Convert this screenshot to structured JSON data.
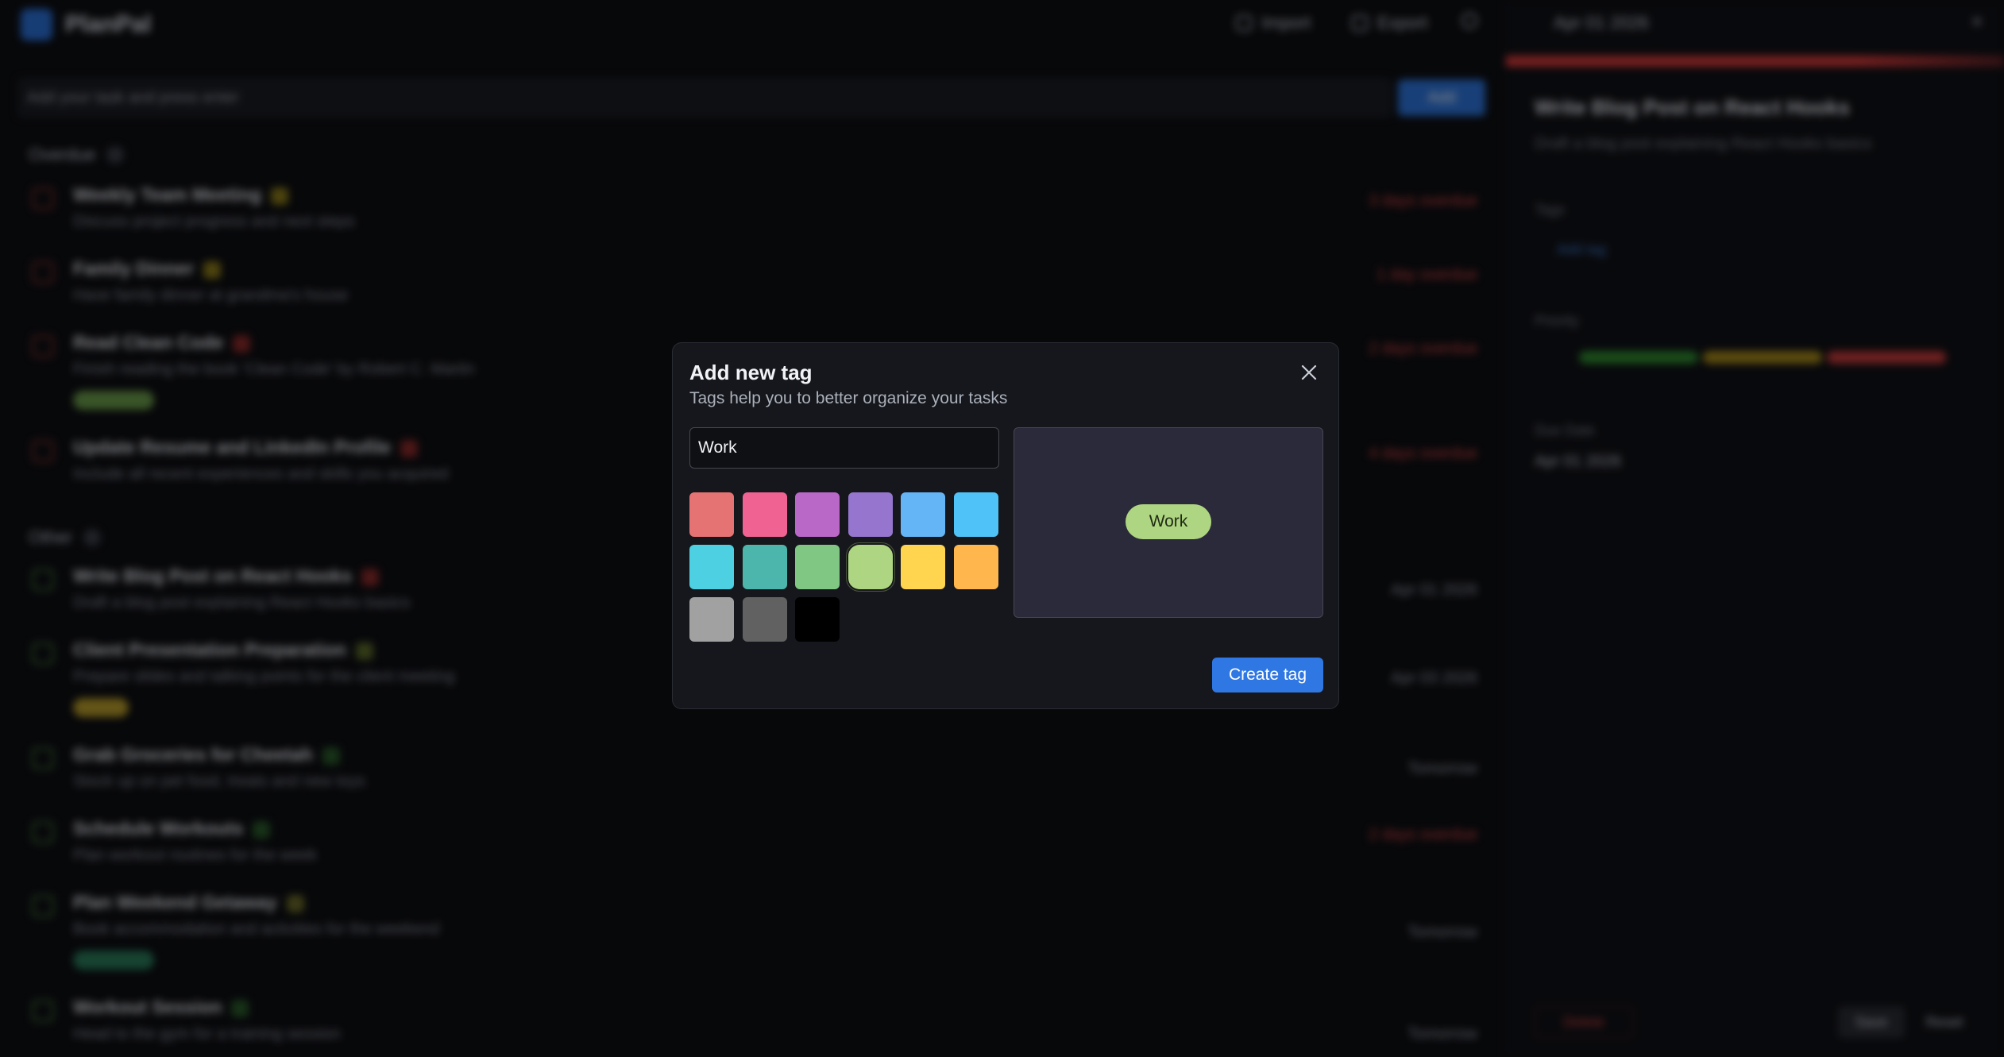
{
  "background": {
    "app_name": "PlanPal",
    "top_actions": [
      "Import",
      "Export"
    ],
    "search_placeholder": "Add your task and press enter",
    "add_label": "Add",
    "sections": [
      {
        "name": "Overdue",
        "tasks": [
          {
            "title": "Weekly Team Meeting",
            "desc": "Discuss project progress and next steps",
            "due": "3 days overdue"
          },
          {
            "title": "Family Dinner",
            "desc": "Have family dinner at grandma's house",
            "due": "1 day overdue"
          },
          {
            "title": "Read Clean Code",
            "desc": "Finish reading the book 'Clean Code' by Robert C. Martin",
            "due": "2 days overdue"
          },
          {
            "title": "Update Resume and LinkedIn Profile",
            "desc": "Include all recent experiences and skills you acquired",
            "due": "4 days overdue"
          }
        ]
      },
      {
        "name": "Other",
        "tasks": [
          {
            "title": "Write Blog Post on React Hooks",
            "desc": "Draft a blog post explaining React Hooks basics",
            "due": "Apr 01 2026"
          },
          {
            "title": "Client Presentation Preparation",
            "desc": "Prepare slides and talking points for the client meeting",
            "due": "Apr 03 2026"
          },
          {
            "title": "Grab Groceries for Cheetah",
            "desc": "Stock up on pet food, treats and new toys",
            "due": "Tomorrow"
          },
          {
            "title": "Schedule Workouts",
            "desc": "Plan workout routines for the week",
            "due": "2 days overdue"
          },
          {
            "title": "Plan Weekend Getaway",
            "desc": "Book accommodation and activities for the weekend",
            "due": "Tomorrow"
          },
          {
            "title": "Workout Session",
            "desc": "Head to the gym for a training session",
            "due": "Tomorrow"
          }
        ]
      }
    ],
    "detail": {
      "date": "Apr 01 2026",
      "title": "Write Blog Post on React Hooks",
      "subtitle": "Draft a blog post explaining React Hooks basics",
      "tags_label": "Tags",
      "add_tag": "Add tag",
      "priority_label": "Priority",
      "due_label": "Due Date",
      "due_value": "Apr 01 2026",
      "delete": "Delete",
      "save": "Save",
      "reset": "Reset"
    }
  },
  "modal": {
    "title": "Add new tag",
    "subtitle": "Tags help you to better organize your tasks",
    "input_value": "Work",
    "preview_label": "Work",
    "create_label": "Create tag",
    "close_icon": "close-icon",
    "selected_color": "#aed581",
    "colors": [
      "#e57373",
      "#f06292",
      "#ba68c8",
      "#9575cd",
      "#64b5f6",
      "#4fc3f7",
      "#4dd0e1",
      "#4db6ac",
      "#81c784",
      "#aed581",
      "#ffd54f",
      "#ffb74d",
      "#a1a1a1",
      "#616161",
      "#000000"
    ]
  }
}
